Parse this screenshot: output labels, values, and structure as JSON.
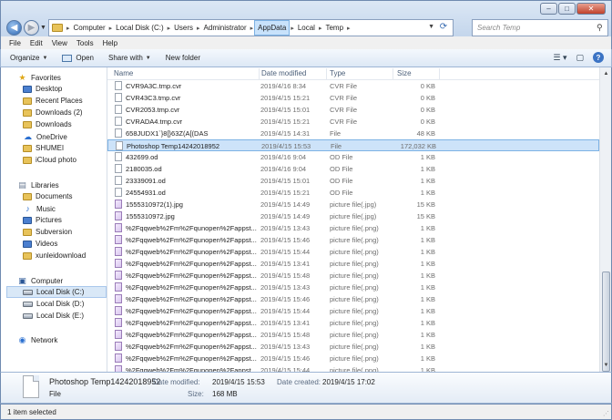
{
  "window": {
    "controls": {
      "minimize": "–",
      "maximize": "□",
      "close": "✕"
    }
  },
  "address": {
    "crumbs": [
      "Computer",
      "Local Disk (C:)",
      "Users",
      "Administrator",
      "AppData",
      "Local",
      "Temp"
    ],
    "selected_crumb": "AppData"
  },
  "search": {
    "placeholder": "Search Temp"
  },
  "menu": [
    "File",
    "Edit",
    "View",
    "Tools",
    "Help"
  ],
  "toolbar": {
    "organize": "Organize",
    "open": "Open",
    "share_with": "Share with",
    "new_folder": "New folder"
  },
  "nav": {
    "favorites": "Favorites",
    "favorites_items": [
      "Desktop",
      "Recent Places",
      "Downloads (2)",
      "Downloads",
      "OneDrive",
      "SHUMEI",
      "iCloud photo"
    ],
    "libraries": "Libraries",
    "libraries_items": [
      "Documents",
      "Music",
      "Pictures",
      "Subversion",
      "Videos",
      "xunleidownload"
    ],
    "computer": "Computer",
    "computer_items": [
      "Local Disk (C:)",
      "Local Disk (D:)",
      "Local Disk (E:)"
    ],
    "network": "Network"
  },
  "columns": {
    "name": "Name",
    "date": "Date modified",
    "type": "Type",
    "size": "Size"
  },
  "files": [
    {
      "name": "CVR9A3C.tmp.cvr",
      "date": "2019/4/16 8:34",
      "type": "CVR File",
      "size": "0 KB",
      "icon": "file"
    },
    {
      "name": "CVR43C3.tmp.cvr",
      "date": "2019/4/15 15:21",
      "type": "CVR File",
      "size": "0 KB",
      "icon": "file"
    },
    {
      "name": "CVR2053.tmp.cvr",
      "date": "2019/4/15 15:01",
      "type": "CVR File",
      "size": "0 KB",
      "icon": "file"
    },
    {
      "name": "CVRADA4.tmp.cvr",
      "date": "2019/4/15 15:21",
      "type": "CVR File",
      "size": "0 KB",
      "icon": "file"
    },
    {
      "name": "658JUDX1`}8[}63Z(A[(DAS",
      "date": "2019/4/15 14:31",
      "type": "File",
      "size": "48 KB",
      "icon": "file"
    },
    {
      "name": "Photoshop Temp14242018952",
      "date": "2019/4/15 15:53",
      "type": "File",
      "size": "172,032 KB",
      "icon": "file",
      "selected": true
    },
    {
      "name": "432699.od",
      "date": "2019/4/16 9:04",
      "type": "OD File",
      "size": "1 KB",
      "icon": "file"
    },
    {
      "name": "2180035.od",
      "date": "2019/4/16 9:04",
      "type": "OD File",
      "size": "1 KB",
      "icon": "file"
    },
    {
      "name": "23339091.od",
      "date": "2019/4/15 15:01",
      "type": "OD File",
      "size": "1 KB",
      "icon": "file"
    },
    {
      "name": "24554931.od",
      "date": "2019/4/15 15:21",
      "type": "OD File",
      "size": "1 KB",
      "icon": "file"
    },
    {
      "name": "1555310972(1).jpg",
      "date": "2019/4/15 14:49",
      "type": "picture file(.jpg)",
      "size": "15 KB",
      "icon": "img"
    },
    {
      "name": "1555310972.jpg",
      "date": "2019/4/15 14:49",
      "type": "picture file(.jpg)",
      "size": "15 KB",
      "icon": "img"
    },
    {
      "name": "%2Fqqweb%2Fm%2Fqunopen%2Fappst...",
      "date": "2019/4/15 13:43",
      "type": "picture file(.png)",
      "size": "1 KB",
      "icon": "img"
    },
    {
      "name": "%2Fqqweb%2Fm%2Fqunopen%2Fappst...",
      "date": "2019/4/15 15:46",
      "type": "picture file(.png)",
      "size": "1 KB",
      "icon": "img"
    },
    {
      "name": "%2Fqqweb%2Fm%2Fqunopen%2Fappst...",
      "date": "2019/4/15 15:44",
      "type": "picture file(.png)",
      "size": "1 KB",
      "icon": "img"
    },
    {
      "name": "%2Fqqweb%2Fm%2Fqunopen%2Fappst...",
      "date": "2019/4/15 13:41",
      "type": "picture file(.png)",
      "size": "1 KB",
      "icon": "img"
    },
    {
      "name": "%2Fqqweb%2Fm%2Fqunopen%2Fappst...",
      "date": "2019/4/15 15:48",
      "type": "picture file(.png)",
      "size": "1 KB",
      "icon": "img"
    },
    {
      "name": "%2Fqqweb%2Fm%2Fqunopen%2Fappst...",
      "date": "2019/4/15 13:43",
      "type": "picture file(.png)",
      "size": "1 KB",
      "icon": "img"
    },
    {
      "name": "%2Fqqweb%2Fm%2Fqunopen%2Fappst...",
      "date": "2019/4/15 15:46",
      "type": "picture file(.png)",
      "size": "1 KB",
      "icon": "img"
    },
    {
      "name": "%2Fqqweb%2Fm%2Fqunopen%2Fappst...",
      "date": "2019/4/15 15:44",
      "type": "picture file(.png)",
      "size": "1 KB",
      "icon": "img"
    },
    {
      "name": "%2Fqqweb%2Fm%2Fqunopen%2Fappst...",
      "date": "2019/4/15 13:41",
      "type": "picture file(.png)",
      "size": "1 KB",
      "icon": "img"
    },
    {
      "name": "%2Fqqweb%2Fm%2Fqunopen%2Fappst...",
      "date": "2019/4/15 15:48",
      "type": "picture file(.png)",
      "size": "1 KB",
      "icon": "img"
    },
    {
      "name": "%2Fqqweb%2Fm%2Fqunopen%2Fappst...",
      "date": "2019/4/15 13:43",
      "type": "picture file(.png)",
      "size": "1 KB",
      "icon": "img"
    },
    {
      "name": "%2Fqqweb%2Fm%2Fqunopen%2Fappst...",
      "date": "2019/4/15 15:46",
      "type": "picture file(.png)",
      "size": "1 KB",
      "icon": "img"
    },
    {
      "name": "%2Fqqweb%2Fm%2Fqunopen%2Fappst...",
      "date": "2019/4/15 15:44",
      "type": "picture file(.png)",
      "size": "1 KB",
      "icon": "img"
    }
  ],
  "details": {
    "name": "Photoshop Temp14242018952",
    "type": "File",
    "date_modified_label": "Date modified:",
    "date_modified": "2019/4/15 15:53",
    "date_created_label": "Date created:",
    "date_created": "2019/4/15 17:02",
    "size_label": "Size:",
    "size": "168 MB"
  },
  "status": {
    "text": "1 item selected"
  }
}
